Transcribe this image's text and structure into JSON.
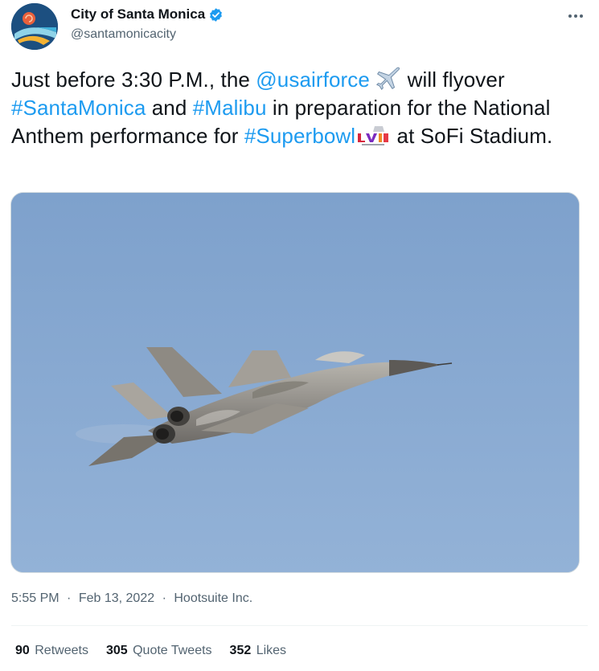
{
  "account": {
    "display_name": "City of Santa Monica",
    "handle": "@santamonicacity",
    "verified": true
  },
  "tweet": {
    "text_before_1": "Just before 3:30 P.M., the ",
    "mention": "@usairforce",
    "text_after_mention": " will flyover ",
    "hashtag_1": "#SantaMonica",
    "text_and": " and ",
    "hashtag_2": "#Malibu",
    "text_middle": " in preparation for the National Anthem performance for ",
    "hashtag_3": "#Superbowl",
    "text_end": " at SoFi Stadium.",
    "emoji_1": "airplane-emoji",
    "emoji_2": "superbowl-lvi-logo"
  },
  "meta": {
    "time": "5:55 PM",
    "separator": "·",
    "date": "Feb 13, 2022",
    "source": "Hootsuite Inc."
  },
  "stats": {
    "retweets_count": "90",
    "retweets_label": "Retweets",
    "quotes_count": "305",
    "quotes_label": "Quote Tweets",
    "likes_count": "352",
    "likes_label": "Likes"
  },
  "colors": {
    "link": "#1d9bf0",
    "text": "#0f1419",
    "muted": "#536471",
    "sky": "#89aad3"
  }
}
